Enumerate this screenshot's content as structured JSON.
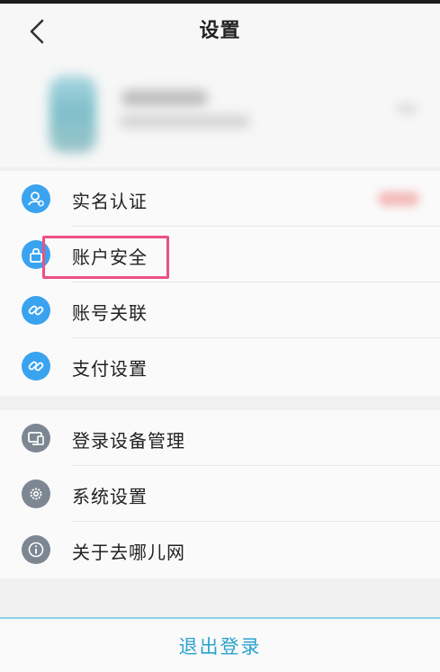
{
  "header": {
    "title": "设置",
    "back_icon": "chevron-left-icon"
  },
  "section1": {
    "items": [
      {
        "label": "实名认证",
        "icon": "user-verified-icon",
        "color": "#3aa3f0"
      },
      {
        "label": "账户安全",
        "icon": "lock-icon",
        "color": "#3aa3f0"
      },
      {
        "label": "账号关联",
        "icon": "link-icon",
        "color": "#3aa3f0"
      },
      {
        "label": "支付设置",
        "icon": "link-icon",
        "color": "#3aa3f0"
      }
    ]
  },
  "section2": {
    "items": [
      {
        "label": "登录设备管理",
        "icon": "devices-icon",
        "color": "#7c8792"
      },
      {
        "label": "系统设置",
        "icon": "gear-icon",
        "color": "#7c8792"
      },
      {
        "label": "关于去哪儿网",
        "icon": "info-icon",
        "color": "#7c8792"
      }
    ]
  },
  "logout": {
    "label": "退出登录",
    "color": "#2aa3cf"
  },
  "highlight": {
    "color": "#ec4f86"
  }
}
